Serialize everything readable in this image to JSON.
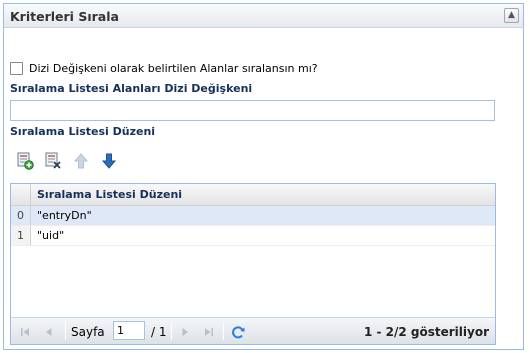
{
  "panel": {
    "title": "Kriterleri Sırala"
  },
  "form": {
    "checkbox_label": "Dizi Değişkeni olarak belirtilen Alanlar sıralansın mı?",
    "checkbox_checked": false,
    "array_field_label": "Sıralama Listesi Alanları Dizi Değişkeni",
    "array_field_value": "",
    "order_label": "Sıralama Listesi Düzeni"
  },
  "toolbar": {
    "buttons": [
      {
        "name": "add-item-icon",
        "enabled": true
      },
      {
        "name": "delete-item-icon",
        "enabled": true
      },
      {
        "name": "move-up-icon",
        "enabled": false
      },
      {
        "name": "move-down-icon",
        "enabled": true
      }
    ]
  },
  "grid": {
    "column_header": "Sıralama Listesi Düzeni",
    "rows": [
      {
        "index": "0",
        "value": "\"entryDn\"",
        "selected": true
      },
      {
        "index": "1",
        "value": "\"uid\"",
        "selected": false
      }
    ]
  },
  "pager": {
    "page_label": "Sayfa",
    "page_value": "1",
    "of_label": "/ 1",
    "status": "1 - 2/2 gösteriliyor"
  },
  "colors": {
    "border": "#99bbe8",
    "label": "#15305a",
    "selected_row": "#dfe8f6",
    "arrow_blue": "#2a6ebb"
  }
}
